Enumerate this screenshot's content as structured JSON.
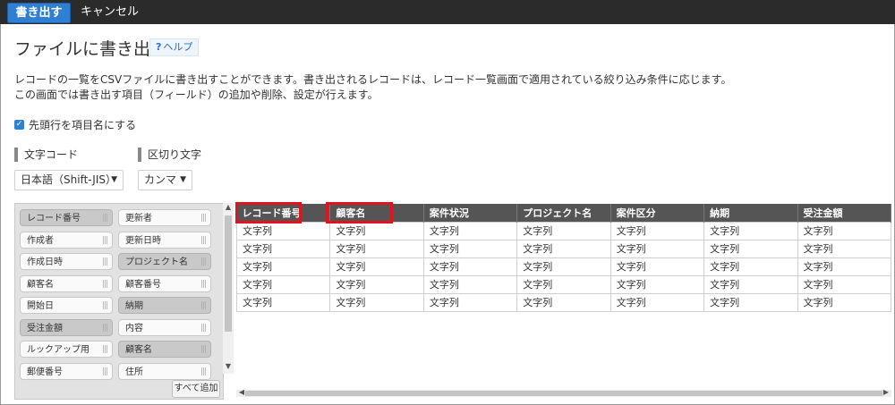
{
  "toolbar": {
    "export_label": "書き出す",
    "cancel_label": "キャンセル"
  },
  "header": {
    "title": "ファイルに書き出す",
    "help_label": "ヘルプ",
    "help_icon": "?"
  },
  "description": {
    "line1": "レコードの一覧をCSVファイルに書き出すことができます。書き出されるレコードは、レコード一覧画面で適用されている絞り込み条件に応じます。",
    "line2": "この画面では書き出す項目（フィールド）の追加や削除、設定が行えます。"
  },
  "options": {
    "header_row_label": "先頭行を項目名にする",
    "header_row_checked": true,
    "encoding_label": "文字コード",
    "encoding_value": "日本語（Shift-JIS）",
    "separator_label": "区切り文字",
    "separator_value": "カンマ"
  },
  "fields": {
    "left": [
      "レコード番号",
      "作成者",
      "作成日時",
      "顧客名",
      "開始日",
      "受注金額",
      "ルックアップ用",
      "郵便番号"
    ],
    "right": [
      "更新者",
      "更新日時",
      "プロジェクト名",
      "顧客番号",
      "納期",
      "内容",
      "顧客名",
      "住所"
    ],
    "used_left": [
      true,
      false,
      false,
      false,
      false,
      true,
      false,
      false
    ],
    "used_right": [
      false,
      false,
      true,
      false,
      true,
      false,
      true,
      false
    ],
    "add_all_label": "すべて追加"
  },
  "table": {
    "columns": [
      "レコード番号",
      "顧客名",
      "案件状況",
      "プロジェクト名",
      "案件区分",
      "納期",
      "受注金額"
    ],
    "cell_value": "文字列",
    "row_count": 5
  },
  "colors": {
    "accent": "#2f7fd3",
    "highlight": "#e0141e",
    "topbar": "#2b2b2b"
  }
}
